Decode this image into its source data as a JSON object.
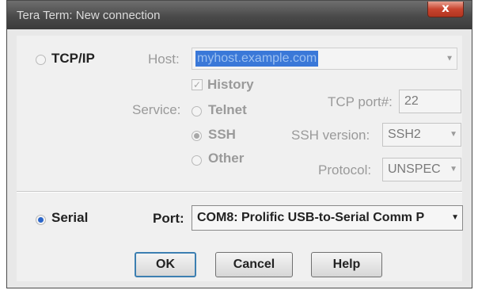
{
  "window": {
    "title": "Tera Term: New connection",
    "close_glyph": "x"
  },
  "tcpip": {
    "radio_label": "TCP/IP",
    "host_label": "Host:",
    "host_value": "myhost.example.com",
    "history_label": "History",
    "service_label": "Service:",
    "services": [
      "Telnet",
      "SSH",
      "Other"
    ],
    "tcp_port_label": "TCP port#:",
    "tcp_port_value": "22",
    "ssh_version_label": "SSH version:",
    "ssh_version_value": "SSH2",
    "protocol_label": "Protocol:",
    "protocol_value": "UNSPEC"
  },
  "serial": {
    "radio_label": "Serial",
    "port_label": "Port:",
    "port_value": "COM8: Prolific USB-to-Serial Comm P"
  },
  "buttons": {
    "ok": "OK",
    "cancel": "Cancel",
    "help": "Help"
  },
  "colors": {
    "accent": "#2b66c9",
    "host_selection": "#3a78d8",
    "title_bar": "#4a4a4a"
  }
}
